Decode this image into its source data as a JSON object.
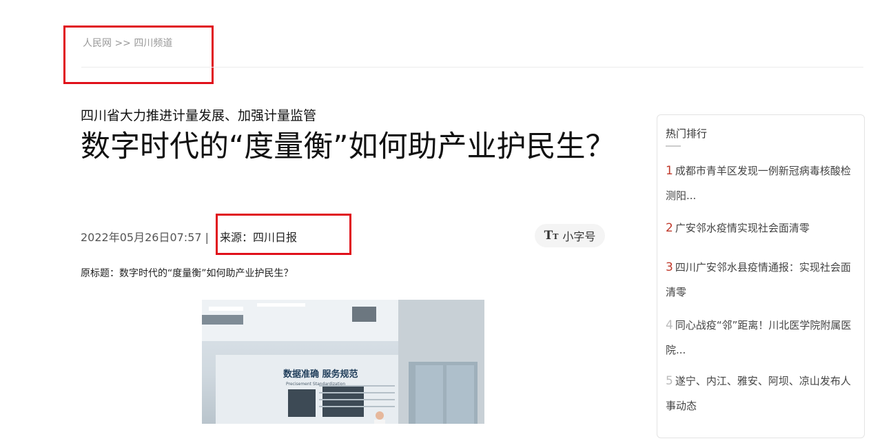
{
  "breadcrumb": {
    "home": "人民网",
    "sep": " >> ",
    "channel": "四川频道"
  },
  "article": {
    "subtitle": "四川省大力推进计量发展、加强计量监管",
    "title": "数字时代的“度量衡”如何助产业护民生？",
    "datetime": "2022年05月26日07:57",
    "meta_sep": " | ",
    "source": "来源：四川日报",
    "font_button_label": "小字号",
    "original_title": "原标题：数字时代的“度量衡”如何助产业护民生？",
    "photo_signs": {
      "left": "数据准确  服务规范",
      "left_sub": "Precisement   Standardization"
    }
  },
  "sidebar": {
    "title": "热门排行",
    "items": [
      {
        "rank": "1",
        "text": "成都市青羊区发现一例新冠病毒核酸检测阳..."
      },
      {
        "rank": "2",
        "text": "广安邻水疫情实现社会面清零"
      },
      {
        "rank": "3",
        "text": "四川广安邻水县疫情通报：实现社会面清零"
      },
      {
        "rank": "4",
        "text": "同心战疫“邻”距离！川北医学院附属医院..."
      },
      {
        "rank": "5",
        "text": "遂宁、内江、雅安、阿坝、凉山发布人事动态"
      }
    ]
  },
  "colors": {
    "highlight": "#e0101a",
    "rank_hot": "#c0392b",
    "rank_normal": "#bbbbbb"
  }
}
